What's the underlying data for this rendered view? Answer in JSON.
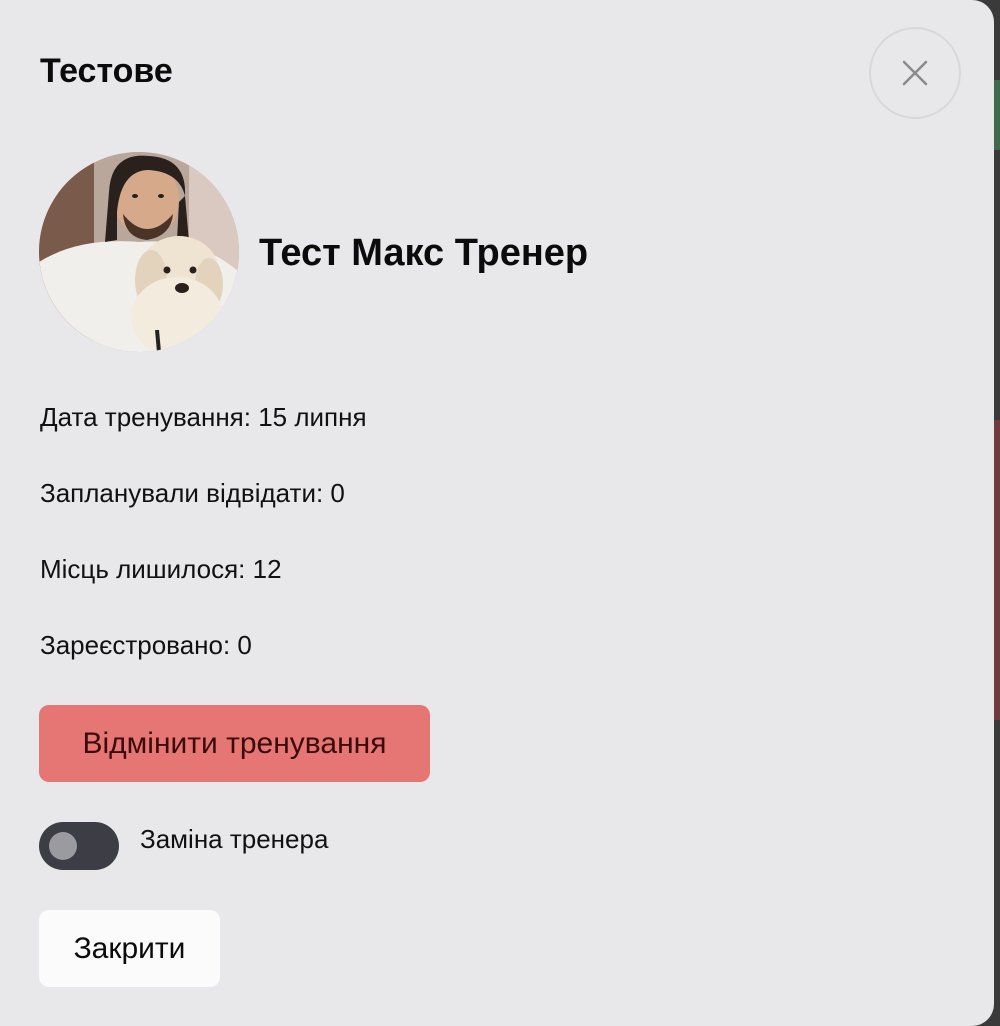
{
  "modal": {
    "title": "Тестове",
    "trainer_name": "Тест Макс Тренер",
    "info": {
      "date_line": "Дата тренування: 15 липня",
      "planned_line": "Запланували відвідати: 0",
      "places_line": "Місць лишилося: 12",
      "registered_line": "Зареєстровано: 0"
    },
    "cancel_training_label": "Відмінити тренування",
    "substitute_trainer": {
      "label": "Заміна тренера",
      "enabled": false
    },
    "close_label": "Закрити"
  },
  "colors": {
    "modal_background": "#e8e8ea",
    "cancel_button": "#e57673",
    "toggle_track": "#3c3d45",
    "close_button": "#fbfbfb"
  },
  "icons": {
    "close": "close-icon"
  }
}
